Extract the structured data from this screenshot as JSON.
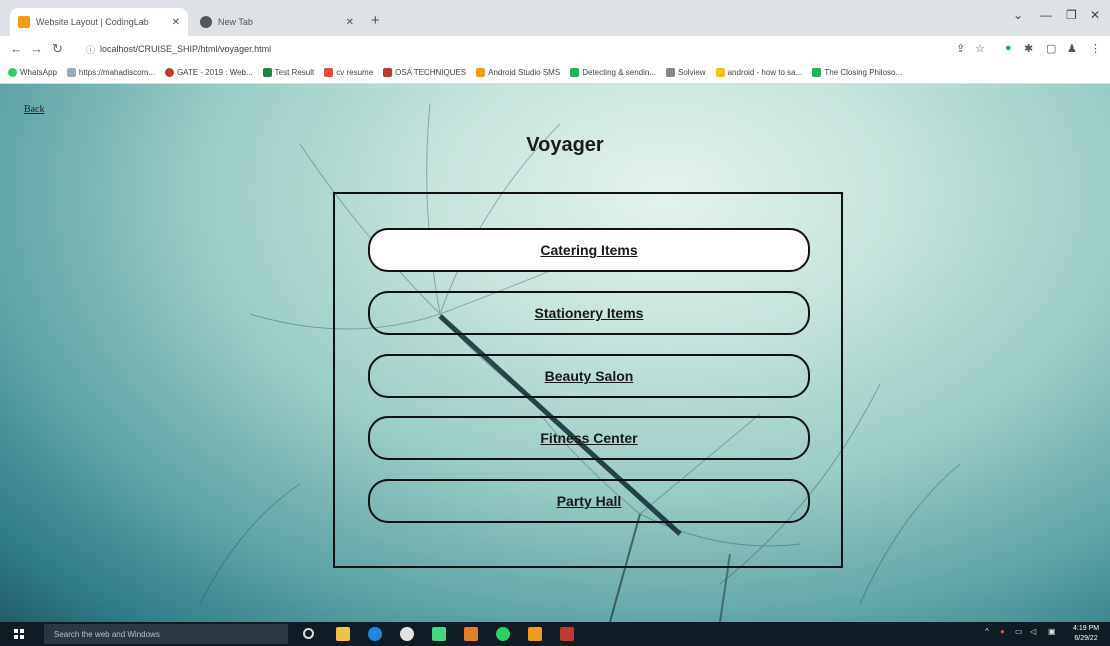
{
  "browser": {
    "tabs": [
      {
        "title": "Website Layout | CodingLab",
        "active": true
      },
      {
        "title": "New Tab",
        "active": false
      }
    ],
    "address": "localhost/CRUISE_SHIP/html/voyager.html",
    "bookmarks": [
      "WhatsApp",
      "https://mahadiscom...",
      "GATE - 2019 : Web...",
      "Test Result",
      "cv resume",
      "OSA TECHNIQUES",
      "Android Studio SMS",
      "Detecting & sendin...",
      "Solview",
      "android - how to sa...",
      "The Closing Philoso..."
    ]
  },
  "page": {
    "back_label": "Back",
    "title": "Voyager",
    "menu": [
      {
        "label": "Catering Items"
      },
      {
        "label": "Stationery Items"
      },
      {
        "label": "Beauty Salon"
      },
      {
        "label": "Fitness Center"
      },
      {
        "label": "Party Hall"
      }
    ]
  },
  "taskbar": {
    "search_placeholder": "Search the web and Windows",
    "time": "4:19 PM",
    "date": "6/29/22"
  },
  "colors": {
    "tab_bar": "#dee1e6",
    "taskbar": "#101c24",
    "button_border": "#111111",
    "bg_teal": "#2f7d86"
  }
}
